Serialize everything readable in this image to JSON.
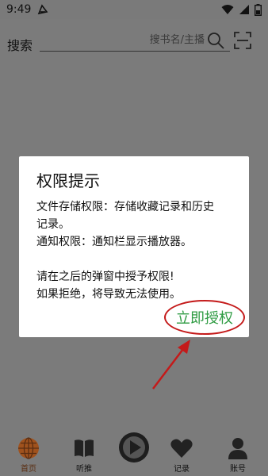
{
  "status_bar": {
    "time": "9:49"
  },
  "search": {
    "label": "搜索",
    "placeholder": "搜书名/主播"
  },
  "dialog": {
    "title": "权限提示",
    "lines": [
      "文件存储权限：存储收藏记录和历史",
      "记录。",
      "通知权限：通知栏显示播放器。",
      "",
      "请在之后的弹窗中授予权限!",
      "如果拒绝，将导致无法使用。"
    ],
    "confirm_label": "立即授权"
  },
  "tabs": [
    {
      "label": "首页",
      "icon": "globe-icon",
      "active": true
    },
    {
      "label": "听推",
      "icon": "book-icon",
      "active": false
    },
    {
      "label": "",
      "icon": "play-icon",
      "active": false
    },
    {
      "label": "记录",
      "icon": "heart-icon",
      "active": false
    },
    {
      "label": "账号",
      "icon": "person-icon",
      "active": false
    }
  ],
  "colors": {
    "overlay_bg": "#7b7b7b",
    "accent_green": "#2e9b42",
    "annotation_red": "#c41a1a",
    "active_tab": "#a0521d"
  }
}
